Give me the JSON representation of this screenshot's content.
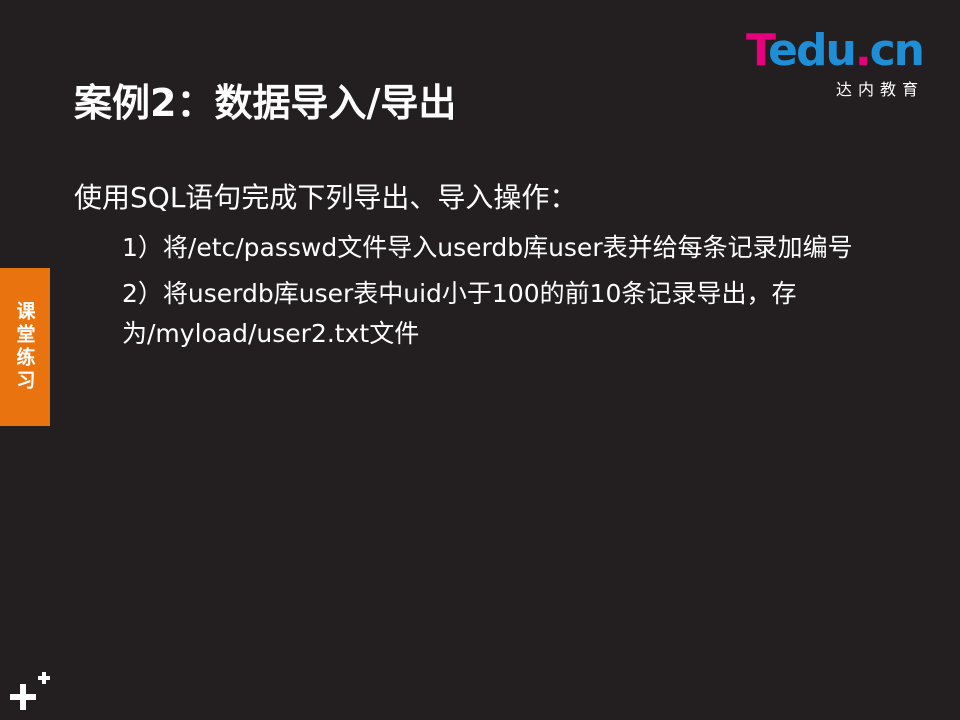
{
  "logo": {
    "brand_t": "T",
    "brand_rest": "edu",
    "brand_dot": ".",
    "brand_tld": "cn",
    "tagline": "达内教育"
  },
  "title": "案例2：数据导入/导出",
  "side_tab": "课堂练习",
  "body": {
    "intro": "使用SQL语句完成下列导出、导入操作：",
    "items": [
      "1）将/etc/passwd文件导入userdb库user表并给每条记录加编号",
      "2）将userdb库user表中uid小于100的前10条记录导出，存为/myload/user2.txt文件"
    ]
  },
  "colors": {
    "background": "#231f20",
    "accent_orange": "#e8730f",
    "logo_magenta": "#e6007e",
    "logo_blue": "#1e8fd6"
  }
}
